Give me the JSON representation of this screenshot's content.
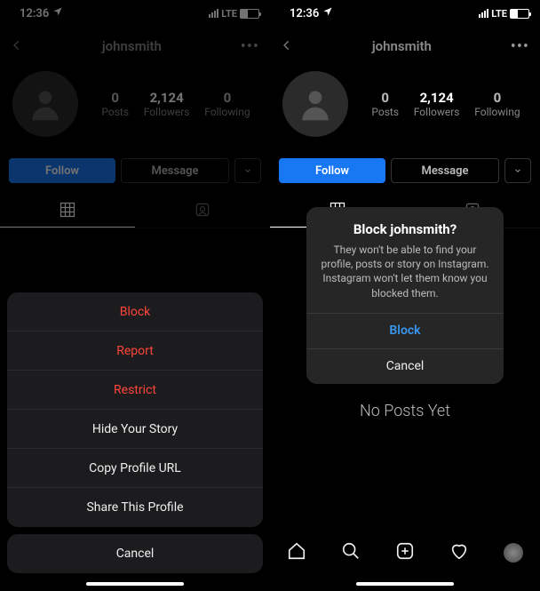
{
  "status": {
    "time": "12:36",
    "network": "LTE"
  },
  "profile": {
    "username": "johnsmith",
    "stats": {
      "posts": {
        "count": "0",
        "label": "Posts"
      },
      "followers": {
        "count": "2,124",
        "label": "Followers"
      },
      "following": {
        "count": "0",
        "label": "Following"
      }
    },
    "follow_label": "Follow",
    "message_label": "Message"
  },
  "action_sheet": {
    "block": "Block",
    "report": "Report",
    "restrict": "Restrict",
    "hide": "Hide Your Story",
    "copy": "Copy Profile URL",
    "share": "Share This Profile",
    "cancel": "Cancel"
  },
  "alert": {
    "title": "Block johnsmith?",
    "body": "They won't be able to find your profile, posts or story on Instagram. Instagram won't let them know you blocked them.",
    "block": "Block",
    "cancel": "Cancel"
  },
  "empty": {
    "no_posts": "No Posts Yet"
  }
}
